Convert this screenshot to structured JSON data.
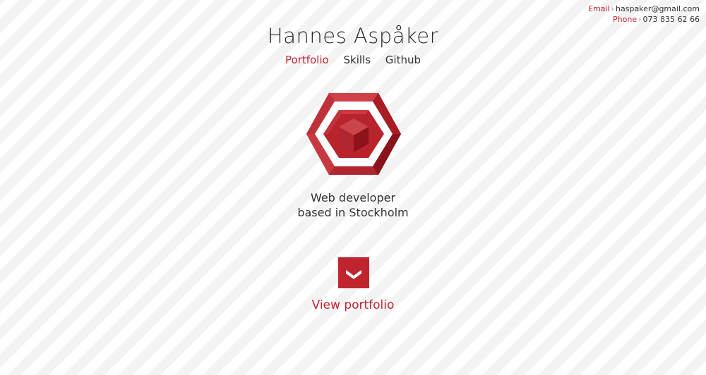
{
  "contact": {
    "email_label": "Email",
    "email_value": "haspaker@gmail.com",
    "phone_label": "Phone",
    "phone_value": "073 835 62 66",
    "separator": "›"
  },
  "header": {
    "title": "Hannes Aspåker"
  },
  "nav": {
    "items": [
      {
        "label": "Portfolio",
        "active": true
      },
      {
        "label": "Skills",
        "active": false
      },
      {
        "label": "Github",
        "active": false
      }
    ]
  },
  "hero": {
    "tagline_line1": "Web developer",
    "tagline_line2": "based in Stockholm",
    "logo_icon": "hexagon-cube-logo",
    "down_icon": "chevron-down-icon",
    "view_link": "View portfolio"
  },
  "colors": {
    "accent": "#c0252f",
    "text": "#2a2a2a",
    "background_stripe": "#f3f3f3"
  }
}
